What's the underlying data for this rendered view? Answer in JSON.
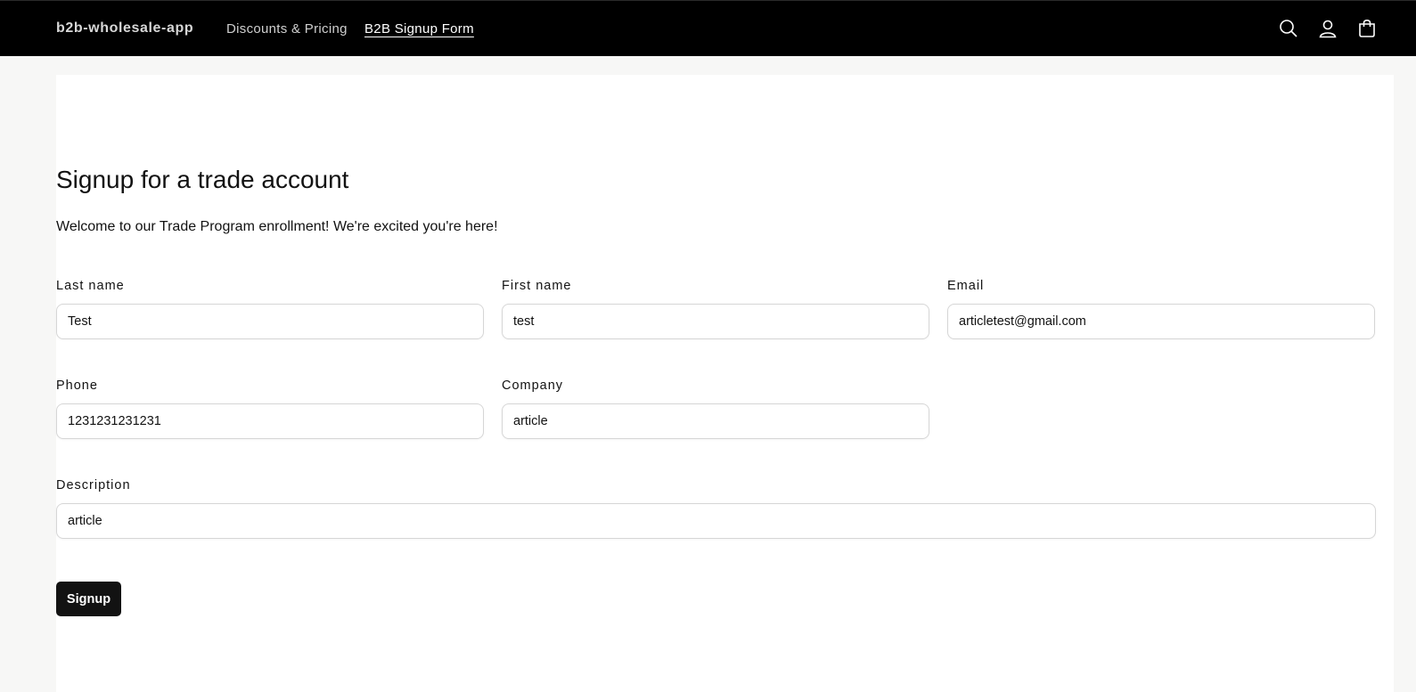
{
  "header": {
    "brand": "b2b-wholesale-app",
    "nav": [
      {
        "label": "Discounts & Pricing"
      },
      {
        "label": "B2B Signup Form"
      }
    ],
    "icons": [
      "search-icon",
      "account-icon",
      "cart-icon"
    ]
  },
  "form": {
    "title": "Signup for a trade account",
    "subtitle": "Welcome to our Trade Program enrollment! We're excited you're here!",
    "last_name": {
      "label": "Last name",
      "value": "Test"
    },
    "first_name": {
      "label": "First name",
      "value": "test"
    },
    "email": {
      "label": "Email",
      "value": "articletest@gmail.com"
    },
    "phone": {
      "label": "Phone",
      "value": "1231231231231"
    },
    "company": {
      "label": "Company",
      "value": "article"
    },
    "description": {
      "label": "Description",
      "value": "article"
    },
    "submit_label": "Signup"
  },
  "colors": {
    "header_bg": "#000000",
    "button_bg": "#121212",
    "page_bg": "#f7f7f6"
  }
}
